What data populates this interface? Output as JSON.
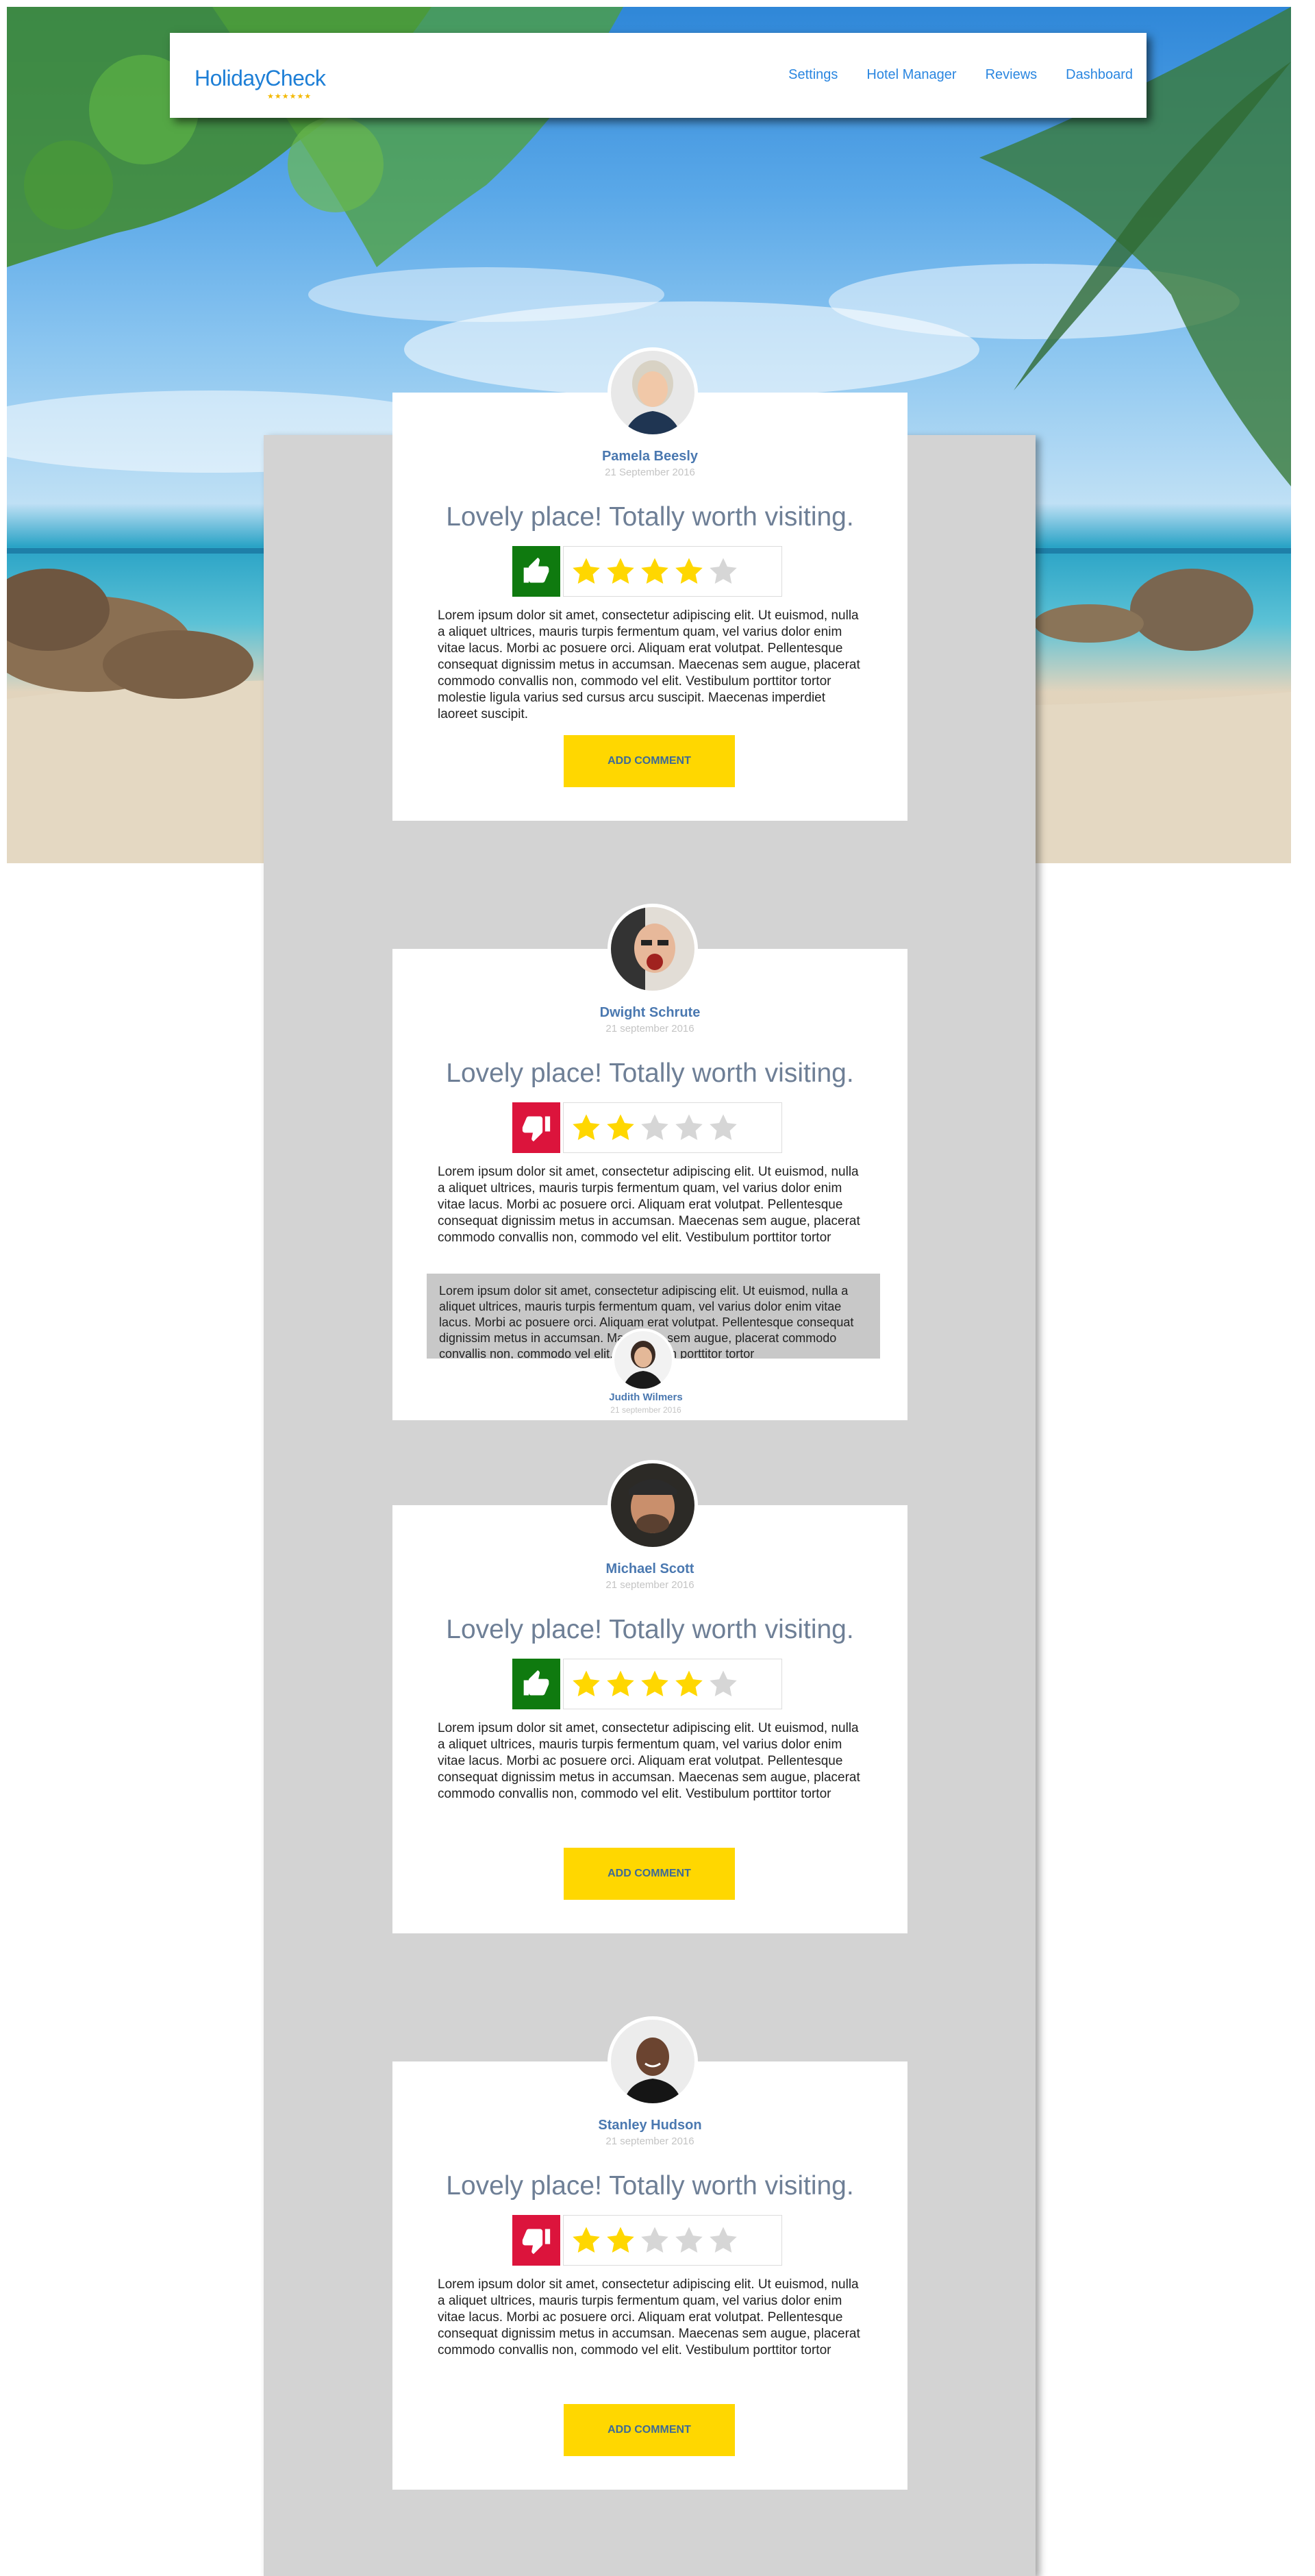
{
  "app": {
    "logo_text": "HolidayCheck",
    "logo_stars": "★★★★★★"
  },
  "nav": {
    "links": [
      "Settings",
      "Hotel Manager",
      "Reviews",
      "Dashboard"
    ]
  },
  "colors": {
    "accent_blue": "#1e7fd6",
    "thumb_up_green": "#0f7a0f",
    "thumb_down_red": "#dc143c",
    "button_yellow": "#ffd700",
    "star_filled": "#ffd700",
    "star_empty": "#d6d6d6"
  },
  "reviews": [
    {
      "name": "Pamela Beesly",
      "date": "21 September 2016",
      "title": "Lovely place! Totally worth visiting.",
      "verdict": "thumbs-up-icon",
      "stars": 4,
      "body": "Lorem ipsum dolor sit amet, consectetur adipiscing elit. Ut euismod, nulla a aliquet ultrices, mauris turpis fermentum quam, vel varius dolor enim vitae lacus. Morbi ac posuere orci. Aliquam erat volutpat. Pellentesque consequat dignissim metus in accumsan. Maecenas sem augue, placerat commodo convallis non, commodo vel elit. Vestibulum porttitor tortor molestie ligula varius sed cursus arcu suscipit. Maecenas imperdiet laoreet suscipit.",
      "button": "ADD COMMENT"
    },
    {
      "name": "Dwight Schrute",
      "date": "21 september 2016",
      "title": "Lovely place! Totally worth visiting.",
      "verdict": "thumbs-down-icon",
      "stars": 2,
      "body": "Lorem ipsum dolor sit amet, consectetur adipiscing elit. Ut euismod, nulla a aliquet ultrices, mauris turpis fermentum quam, vel varius dolor enim vitae lacus. Morbi ac posuere orci. Aliquam erat volutpat. Pellentesque consequat dignissim metus in accumsan. Maecenas sem augue, placerat commodo convallis non, commodo vel elit. Vestibulum porttitor tortor molestie ligula varius sed cursus arcu",
      "comment": {
        "text": "Lorem ipsum dolor sit amet, consectetur adipiscing elit. Ut euismod, nulla a aliquet ultrices, mauris turpis fermentum quam, vel varius dolor enim vitae lacus. Morbi ac posuere orci. Aliquam erat volutpat. Pellentesque consequat dignissim metus in accumsan. Maecenas sem augue, placerat commodo convallis non, commodo vel elit. Vestibulum porttitor tortor",
        "name": "Judith Wilmers",
        "date": "21 september 2016"
      }
    },
    {
      "name": "Michael Scott",
      "date": "21 september 2016",
      "title": "Lovely place! Totally worth visiting.",
      "verdict": "thumbs-up-icon",
      "stars": 4,
      "body": "Lorem ipsum dolor sit amet, consectetur adipiscing elit. Ut euismod, nulla a aliquet ultrices, mauris turpis fermentum quam, vel varius dolor enim vitae lacus. Morbi ac posuere orci. Aliquam erat volutpat. Pellentesque consequat dignissim metus in accumsan. Maecenas sem augue, placerat commodo convallis non, commodo vel elit. Vestibulum porttitor tortor molestie ligula varius sed cursus arcu",
      "button": "ADD COMMENT"
    },
    {
      "name": "Stanley Hudson",
      "date": "21 september 2016",
      "title": "Lovely place! Totally worth visiting.",
      "verdict": "thumbs-down-icon",
      "stars": 2,
      "body": "Lorem ipsum dolor sit amet, consectetur adipiscing elit. Ut euismod, nulla a aliquet ultrices, mauris turpis fermentum quam, vel varius dolor enim vitae lacus. Morbi ac posuere orci. Aliquam erat volutpat. Pellentesque consequat dignissim metus in accumsan. Maecenas sem augue, placerat commodo convallis non, commodo vel elit. Vestibulum porttitor tortor molestie ligula varius sed cursus arcu",
      "button": "ADD COMMENT"
    }
  ]
}
